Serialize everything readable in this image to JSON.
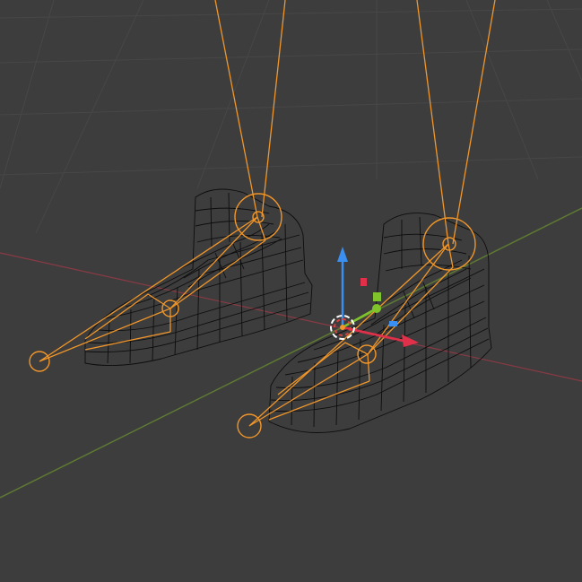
{
  "viewport": {
    "background": "#3d3d3d",
    "grid_color": "#474747",
    "x_axis_color": "#8a3a44",
    "y_axis_color": "#5e7a32",
    "selection_color": "#f0962a",
    "wire_color": "#0d0d0d"
  },
  "gizmo": {
    "icons": [
      "translate-arrow-z-icon",
      "translate-arrow-x-icon",
      "translate-arrow-y-icon",
      "pivot-ring-icon"
    ],
    "z_color": "#3a8ff0",
    "x_color": "#e0304a",
    "y_color": "#7ec42a"
  }
}
